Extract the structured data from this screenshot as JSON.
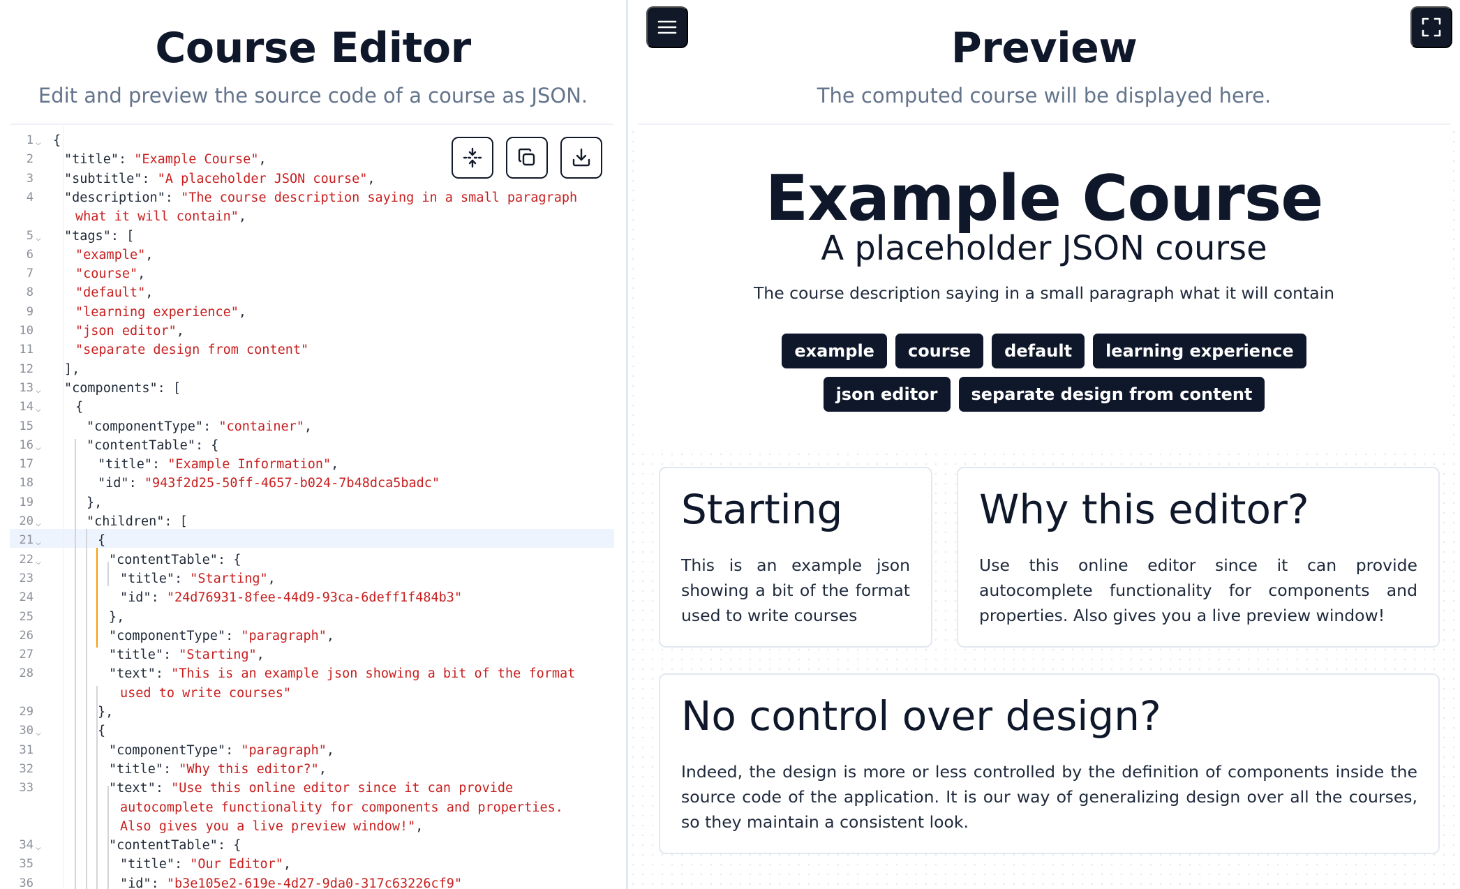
{
  "editor": {
    "title": "Course Editor",
    "subtitle": "Edit and preview the source code of a course as JSON.",
    "toolbar": {
      "format_icon": "expand-vertical-icon",
      "copy_icon": "copy-icon",
      "download_icon": "download-icon"
    },
    "lines": [
      {
        "n": "1",
        "fold": true,
        "indent": 0,
        "parts": [
          [
            "p",
            "{"
          ]
        ]
      },
      {
        "n": "2",
        "fold": false,
        "indent": 1,
        "parts": [
          [
            "k",
            "\"title\""
          ],
          [
            "p",
            ": "
          ],
          [
            "s",
            "\"Example Course\""
          ],
          [
            "p",
            ","
          ]
        ]
      },
      {
        "n": "3",
        "fold": false,
        "indent": 1,
        "parts": [
          [
            "k",
            "\"subtitle\""
          ],
          [
            "p",
            ": "
          ],
          [
            "s",
            "\"A placeholder JSON course\""
          ],
          [
            "p",
            ","
          ]
        ]
      },
      {
        "n": "4",
        "fold": false,
        "indent": 1,
        "parts": [
          [
            "k",
            "\"description\""
          ],
          [
            "p",
            ": "
          ],
          [
            "s",
            "\"The course description saying in a small paragraph"
          ]
        ]
      },
      {
        "n": "",
        "fold": false,
        "indent": 2,
        "parts": [
          [
            "s",
            "what it will contain\""
          ],
          [
            "p",
            ","
          ]
        ]
      },
      {
        "n": "5",
        "fold": true,
        "indent": 1,
        "parts": [
          [
            "k",
            "\"tags\""
          ],
          [
            "p",
            ": ["
          ]
        ]
      },
      {
        "n": "6",
        "fold": false,
        "indent": 2,
        "parts": [
          [
            "s",
            "\"example\""
          ],
          [
            "p",
            ","
          ]
        ]
      },
      {
        "n": "7",
        "fold": false,
        "indent": 2,
        "parts": [
          [
            "s",
            "\"course\""
          ],
          [
            "p",
            ","
          ]
        ]
      },
      {
        "n": "8",
        "fold": false,
        "indent": 2,
        "parts": [
          [
            "s",
            "\"default\""
          ],
          [
            "p",
            ","
          ]
        ]
      },
      {
        "n": "9",
        "fold": false,
        "indent": 2,
        "parts": [
          [
            "s",
            "\"learning experience\""
          ],
          [
            "p",
            ","
          ]
        ]
      },
      {
        "n": "10",
        "fold": false,
        "indent": 2,
        "parts": [
          [
            "s",
            "\"json editor\""
          ],
          [
            "p",
            ","
          ]
        ]
      },
      {
        "n": "11",
        "fold": false,
        "indent": 2,
        "parts": [
          [
            "s",
            "\"separate design from content\""
          ]
        ]
      },
      {
        "n": "12",
        "fold": false,
        "indent": 1,
        "parts": [
          [
            "p",
            "],"
          ]
        ]
      },
      {
        "n": "13",
        "fold": true,
        "indent": 1,
        "parts": [
          [
            "k",
            "\"components\""
          ],
          [
            "p",
            ": ["
          ]
        ]
      },
      {
        "n": "14",
        "fold": true,
        "indent": 2,
        "parts": [
          [
            "p",
            "{"
          ]
        ]
      },
      {
        "n": "15",
        "fold": false,
        "indent": 3,
        "parts": [
          [
            "k",
            "\"componentType\""
          ],
          [
            "p",
            ": "
          ],
          [
            "s",
            "\"container\""
          ],
          [
            "p",
            ","
          ]
        ]
      },
      {
        "n": "16",
        "fold": true,
        "indent": 3,
        "parts": [
          [
            "k",
            "\"contentTable\""
          ],
          [
            "p",
            ": {"
          ]
        ]
      },
      {
        "n": "17",
        "fold": false,
        "indent": 4,
        "parts": [
          [
            "k",
            "\"title\""
          ],
          [
            "p",
            ": "
          ],
          [
            "s",
            "\"Example Information\""
          ],
          [
            "p",
            ","
          ]
        ]
      },
      {
        "n": "18",
        "fold": false,
        "indent": 4,
        "parts": [
          [
            "k",
            "\"id\""
          ],
          [
            "p",
            ": "
          ],
          [
            "s",
            "\"943f2d25-50ff-4657-b024-7b48dca5badc\""
          ]
        ]
      },
      {
        "n": "19",
        "fold": false,
        "indent": 3,
        "parts": [
          [
            "p",
            "},"
          ]
        ]
      },
      {
        "n": "20",
        "fold": true,
        "indent": 3,
        "parts": [
          [
            "k",
            "\"children\""
          ],
          [
            "p",
            ": ["
          ]
        ]
      },
      {
        "n": "21",
        "fold": true,
        "indent": 4,
        "parts": [
          [
            "p",
            "{"
          ]
        ]
      },
      {
        "n": "22",
        "fold": true,
        "indent": 5,
        "parts": [
          [
            "k",
            "\"contentTable\""
          ],
          [
            "p",
            ": {"
          ]
        ]
      },
      {
        "n": "23",
        "fold": false,
        "indent": 6,
        "parts": [
          [
            "k",
            "\"title\""
          ],
          [
            "p",
            ": "
          ],
          [
            "s",
            "\"Starting\""
          ],
          [
            "p",
            ","
          ]
        ]
      },
      {
        "n": "24",
        "fold": false,
        "indent": 6,
        "parts": [
          [
            "k",
            "\"id\""
          ],
          [
            "p",
            ": "
          ],
          [
            "s",
            "\"24d76931-8fee-44d9-93ca-6deff1f484b3\""
          ]
        ]
      },
      {
        "n": "25",
        "fold": false,
        "indent": 5,
        "parts": [
          [
            "p",
            "},"
          ]
        ]
      },
      {
        "n": "26",
        "fold": false,
        "indent": 5,
        "parts": [
          [
            "k",
            "\"componentType\""
          ],
          [
            "p",
            ": "
          ],
          [
            "s",
            "\"paragraph\""
          ],
          [
            "p",
            ","
          ]
        ]
      },
      {
        "n": "27",
        "fold": false,
        "indent": 5,
        "parts": [
          [
            "k",
            "\"title\""
          ],
          [
            "p",
            ": "
          ],
          [
            "s",
            "\"Starting\""
          ],
          [
            "p",
            ","
          ]
        ]
      },
      {
        "n": "28",
        "fold": false,
        "indent": 5,
        "parts": [
          [
            "k",
            "\"text\""
          ],
          [
            "p",
            ": "
          ],
          [
            "s",
            "\"This is an example json showing a bit of the format"
          ]
        ]
      },
      {
        "n": "",
        "fold": false,
        "indent": 6,
        "parts": [
          [
            "s",
            "used to write courses\""
          ]
        ]
      },
      {
        "n": "29",
        "fold": false,
        "indent": 4,
        "parts": [
          [
            "p",
            "},"
          ]
        ]
      },
      {
        "n": "30",
        "fold": true,
        "indent": 4,
        "parts": [
          [
            "p",
            "{"
          ]
        ]
      },
      {
        "n": "31",
        "fold": false,
        "indent": 5,
        "parts": [
          [
            "k",
            "\"componentType\""
          ],
          [
            "p",
            ": "
          ],
          [
            "s",
            "\"paragraph\""
          ],
          [
            "p",
            ","
          ]
        ]
      },
      {
        "n": "32",
        "fold": false,
        "indent": 5,
        "parts": [
          [
            "k",
            "\"title\""
          ],
          [
            "p",
            ": "
          ],
          [
            "s",
            "\"Why this editor?\""
          ],
          [
            "p",
            ","
          ]
        ]
      },
      {
        "n": "33",
        "fold": false,
        "indent": 5,
        "parts": [
          [
            "k",
            "\"text\""
          ],
          [
            "p",
            ": "
          ],
          [
            "s",
            "\"Use this online editor since it can provide"
          ]
        ]
      },
      {
        "n": "",
        "fold": false,
        "indent": 6,
        "parts": [
          [
            "s",
            "autocomplete functionality for components and properties."
          ]
        ]
      },
      {
        "n": "",
        "fold": false,
        "indent": 6,
        "parts": [
          [
            "s",
            "Also gives you a live preview window!\""
          ],
          [
            "p",
            ","
          ]
        ]
      },
      {
        "n": "34",
        "fold": true,
        "indent": 5,
        "parts": [
          [
            "k",
            "\"contentTable\""
          ],
          [
            "p",
            ": {"
          ]
        ]
      },
      {
        "n": "35",
        "fold": false,
        "indent": 6,
        "parts": [
          [
            "k",
            "\"title\""
          ],
          [
            "p",
            ": "
          ],
          [
            "s",
            "\"Our Editor\""
          ],
          [
            "p",
            ","
          ]
        ]
      },
      {
        "n": "36",
        "fold": false,
        "indent": 6,
        "parts": [
          [
            "k",
            "\"id\""
          ],
          [
            "p",
            ": "
          ],
          [
            "s",
            "\"b3e105e2-619e-4d27-9da0-317c63226cf9\""
          ]
        ]
      }
    ]
  },
  "preview": {
    "title": "Preview",
    "subtitle": "The computed course will be displayed here.",
    "menu_icon": "hamburger-menu-icon",
    "fullscreen_icon": "fullscreen-icon",
    "course": {
      "title": "Example Course",
      "subtitle": "A placeholder JSON course",
      "description": "The course description saying in a small paragraph what it will contain",
      "tags": [
        "example",
        "course",
        "default",
        "learning experience",
        "json editor",
        "separate design from content"
      ],
      "cards": [
        {
          "title": "Starting",
          "text": "This is an example json showing a bit of the format used to write courses"
        },
        {
          "title": "Why this editor?",
          "text": "Use this online editor since it can provide autocomplete functionality for components and properties. Also gives you a live preview window!"
        },
        {
          "title": "No control over design?",
          "text": "Indeed, the design is more or less controlled by the definition of components inside the source code of the application. It is our way of generalizing design over all the courses, so they maintain a consistent look."
        }
      ]
    }
  },
  "colors": {
    "dark": "#0f172a",
    "muted": "#64748b",
    "string": "#c81e1e",
    "active_guide": "#f59e0b",
    "active_line": "#eef4fd"
  }
}
